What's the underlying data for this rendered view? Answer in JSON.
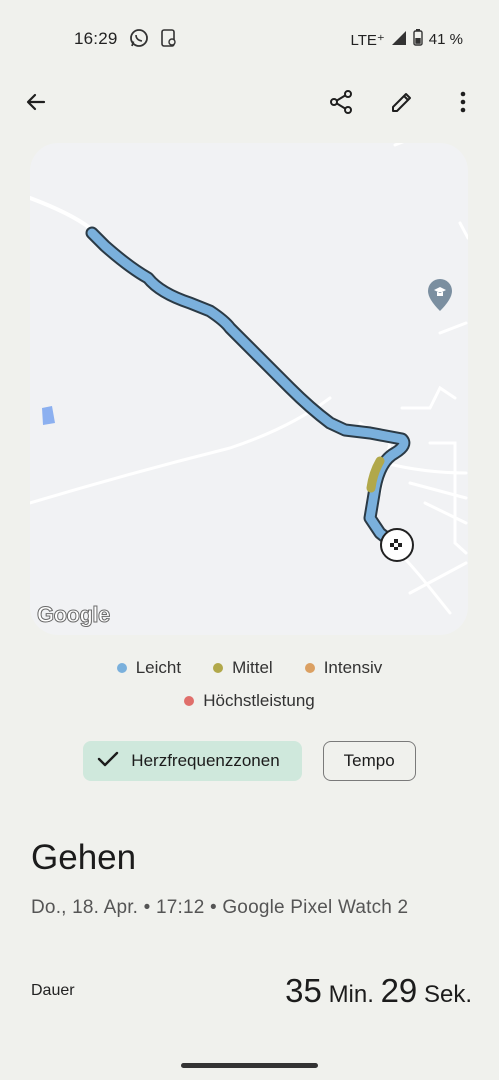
{
  "status_bar": {
    "time": "16:29",
    "network": "LTE⁺",
    "battery": "41 %",
    "icons": [
      "whatsapp-icon",
      "screen-share-icon",
      "signal-icon",
      "battery-icon"
    ]
  },
  "toolbar": {
    "icons": [
      "back-arrow-icon",
      "share-icon",
      "edit-pencil-icon",
      "more-vert-icon"
    ]
  },
  "map": {
    "attribution": "Google",
    "route_zones": [
      "Leicht",
      "Mittel"
    ],
    "markers": [
      "school-pin-icon",
      "finish-flag-icon"
    ]
  },
  "legend": {
    "items": [
      {
        "label": "Leicht",
        "color": "#7ab0dc"
      },
      {
        "label": "Mittel",
        "color": "#b1a84a"
      },
      {
        "label": "Intensiv",
        "color": "#dba062"
      },
      {
        "label": "Höchstleistung",
        "color": "#e06f6b"
      }
    ]
  },
  "chips": {
    "heart_rate": "Herzfrequenzzonen",
    "tempo": "Tempo",
    "selected": "Herzfrequenzzonen"
  },
  "activity": {
    "title": "Gehen",
    "subtitle": "Do., 18. Apr. • 17:12 • Google Pixel Watch 2"
  },
  "metrics": {
    "duration_label": "Dauer",
    "minutes": "35",
    "min_unit": "Min.",
    "seconds": "29",
    "sec_unit": "Sek."
  },
  "colors": {
    "background": "#f0f1ed",
    "accent_chip": "#cfe8dc",
    "route_light": "#7ab0dc",
    "route_medium": "#b1a84a"
  }
}
